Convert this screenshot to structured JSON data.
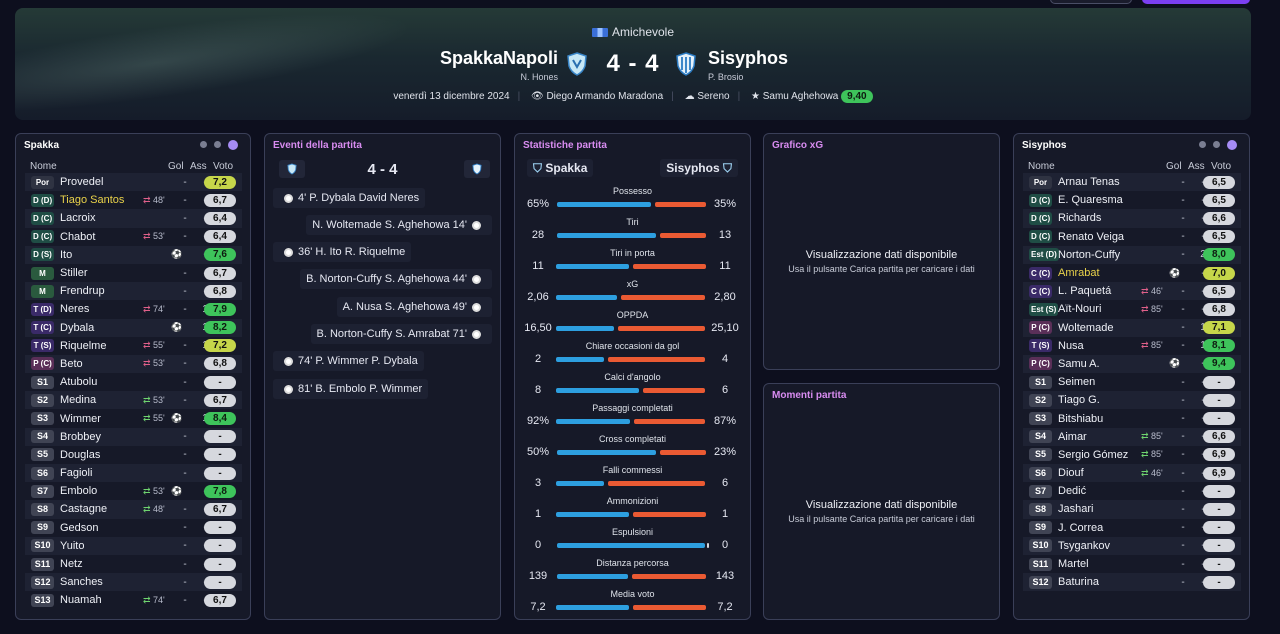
{
  "header": {
    "competition": "Amichevole",
    "home": {
      "name": "SpakkaNapoli",
      "coach": "N. Hones"
    },
    "away": {
      "name": "Sisyphos",
      "coach": "P. Brosio"
    },
    "score": "4 - 4",
    "date": "venerdì 13 dicembre 2024",
    "stadium": "Diego Armando Maradona",
    "weather": "Sereno",
    "mvp": "Samu Aghehowa",
    "mvp_rating": "9,40"
  },
  "labels": {
    "nome": "Nome",
    "gol": "Gol",
    "ass": "Ass",
    "voto": "Voto"
  },
  "home_panel": {
    "title": "Spakka",
    "players": [
      {
        "pos": "Por",
        "name": "Provedel",
        "sub": "",
        "gol": "-",
        "ass": "-",
        "vote": "7,2",
        "cls": "v-ygreen",
        "pc": "gk"
      },
      {
        "pos": "D (D)",
        "name": "Tiago Santos",
        "sub": "48'",
        "subdir": "out",
        "gol": "-",
        "ass": "-",
        "vote": "6,7",
        "cls": "v-gray",
        "pc": "def",
        "hl": true
      },
      {
        "pos": "D (C)",
        "name": "Lacroix",
        "sub": "",
        "gol": "-",
        "ass": "-",
        "vote": "6,4",
        "cls": "v-gray",
        "pc": "def"
      },
      {
        "pos": "D (C)",
        "name": "Chabot",
        "sub": "53'",
        "subdir": "out",
        "gol": "-",
        "ass": "-",
        "vote": "6,4",
        "cls": "v-gray",
        "pc": "def"
      },
      {
        "pos": "D (S)",
        "name": "Ito",
        "sub": "",
        "goalicon": true,
        "gol": "",
        "ass": "-",
        "vote": "7,6",
        "cls": "v-green",
        "pc": "def"
      },
      {
        "pos": "M",
        "name": "Stiller",
        "sub": "",
        "gol": "-",
        "ass": "-",
        "vote": "6,7",
        "cls": "v-gray",
        "pc": "mid"
      },
      {
        "pos": "M",
        "name": "Frendrup",
        "sub": "",
        "gol": "-",
        "ass": "-",
        "vote": "6,8",
        "cls": "v-gray",
        "pc": "mid"
      },
      {
        "pos": "T (D)",
        "name": "Neres",
        "sub": "74'",
        "subdir": "out",
        "gol": "-",
        "ass": "1",
        "vote": "7,9",
        "cls": "v-green",
        "pc": "mix"
      },
      {
        "pos": "T (C)",
        "name": "Dybala",
        "sub": "",
        "goalicon": true,
        "gol": "",
        "ass": "1",
        "vote": "8,2",
        "cls": "v-green",
        "pc": "mix"
      },
      {
        "pos": "T (S)",
        "name": "Riquelme",
        "sub": "55'",
        "subdir": "out",
        "gol": "-",
        "ass": "1",
        "vote": "7,2",
        "cls": "v-ygreen",
        "pc": "mix"
      },
      {
        "pos": "P (C)",
        "name": "Beto",
        "sub": "53'",
        "subdir": "out",
        "gol": "-",
        "ass": "-",
        "vote": "6,8",
        "cls": "v-gray",
        "pc": "att"
      },
      {
        "pos": "S1",
        "name": "Atubolu",
        "sub": "",
        "gol": "-",
        "ass": "-",
        "vote": "-",
        "cls": "v-dash",
        "pc": "sub"
      },
      {
        "pos": "S2",
        "name": "Medina",
        "sub": "53'",
        "subdir": "in",
        "gol": "-",
        "ass": "-",
        "vote": "6,7",
        "cls": "v-gray",
        "pc": "sub"
      },
      {
        "pos": "S3",
        "name": "Wimmer",
        "sub": "55'",
        "subdir": "in",
        "goalicon": true,
        "gol": "",
        "ass": "1",
        "vote": "8,4",
        "cls": "v-green",
        "pc": "sub"
      },
      {
        "pos": "S4",
        "name": "Brobbey",
        "sub": "",
        "gol": "-",
        "ass": "-",
        "vote": "-",
        "cls": "v-dash",
        "pc": "sub"
      },
      {
        "pos": "S5",
        "name": "Douglas",
        "sub": "",
        "gol": "-",
        "ass": "-",
        "vote": "-",
        "cls": "v-dash",
        "pc": "sub"
      },
      {
        "pos": "S6",
        "name": "Fagioli",
        "sub": "",
        "gol": "-",
        "ass": "-",
        "vote": "-",
        "cls": "v-dash",
        "pc": "sub"
      },
      {
        "pos": "S7",
        "name": "Embolo",
        "sub": "53'",
        "subdir": "in",
        "goalicon": true,
        "gol": "",
        "ass": "-",
        "vote": "7,8",
        "cls": "v-green",
        "pc": "sub"
      },
      {
        "pos": "S8",
        "name": "Castagne",
        "sub": "48'",
        "subdir": "in",
        "gol": "-",
        "ass": "-",
        "vote": "6,7",
        "cls": "v-gray",
        "pc": "sub"
      },
      {
        "pos": "S9",
        "name": "Gedson",
        "sub": "",
        "gol": "-",
        "ass": "-",
        "vote": "-",
        "cls": "v-dash",
        "pc": "sub"
      },
      {
        "pos": "S10",
        "name": "Yuito",
        "sub": "",
        "gol": "-",
        "ass": "-",
        "vote": "-",
        "cls": "v-dash",
        "pc": "sub"
      },
      {
        "pos": "S11",
        "name": "Netz",
        "sub": "",
        "gol": "-",
        "ass": "-",
        "vote": "-",
        "cls": "v-dash",
        "pc": "sub"
      },
      {
        "pos": "S12",
        "name": "Sanches",
        "sub": "",
        "gol": "-",
        "ass": "-",
        "vote": "-",
        "cls": "v-dash",
        "pc": "sub"
      },
      {
        "pos": "S13",
        "name": "Nuamah",
        "sub": "74'",
        "subdir": "in",
        "gol": "-",
        "ass": "-",
        "vote": "6,7",
        "cls": "v-gray",
        "pc": "sub"
      }
    ]
  },
  "away_panel": {
    "title": "Sisyphos",
    "players": [
      {
        "pos": "Por",
        "name": "Arnau Tenas",
        "sub": "",
        "gol": "-",
        "ass": "-",
        "vote": "6,5",
        "cls": "v-gray",
        "pc": "gk"
      },
      {
        "pos": "D (C)",
        "name": "E. Quaresma",
        "sub": "",
        "gol": "-",
        "ass": "-",
        "vote": "6,5",
        "cls": "v-gray",
        "pc": "def"
      },
      {
        "pos": "D (C)",
        "name": "Richards",
        "sub": "",
        "gol": "-",
        "ass": "-",
        "vote": "6,6",
        "cls": "v-gray",
        "pc": "def"
      },
      {
        "pos": "D (C)",
        "name": "Renato Veiga",
        "sub": "",
        "gol": "-",
        "ass": "-",
        "vote": "6,5",
        "cls": "v-gray",
        "pc": "def"
      },
      {
        "pos": "Est (D)",
        "name": "Norton-Cuffy",
        "sub": "",
        "gol": "-",
        "ass": "2",
        "vote": "8,0",
        "cls": "v-green",
        "pc": "def"
      },
      {
        "pos": "C (C)",
        "name": "Amrabat",
        "sub": "",
        "goalicon": true,
        "gol": "",
        "ass": "-",
        "vote": "7,0",
        "cls": "v-ygreen",
        "pc": "mix",
        "hl": true
      },
      {
        "pos": "C (C)",
        "name": "L. Paquetá",
        "sub": "46'",
        "subdir": "out",
        "gol": "-",
        "ass": "-",
        "vote": "6,5",
        "cls": "v-gray",
        "pc": "mix"
      },
      {
        "pos": "Est (S)",
        "name": "Aït-Nouri",
        "sub": "85'",
        "subdir": "out",
        "gol": "-",
        "ass": "-",
        "vote": "6,8",
        "cls": "v-gray",
        "pc": "def"
      },
      {
        "pos": "P (C)",
        "name": "Woltemade",
        "sub": "",
        "gol": "-",
        "ass": "1",
        "vote": "7,1",
        "cls": "v-ygreen",
        "pc": "att"
      },
      {
        "pos": "T (S)",
        "name": "Nusa",
        "sub": "85'",
        "subdir": "out",
        "gol": "-",
        "ass": "1",
        "vote": "8,1",
        "cls": "v-green",
        "pc": "mix"
      },
      {
        "pos": "P (C)",
        "name": "Samu A.",
        "sub": "",
        "goalicon": true,
        "gol": "",
        "ass": "-",
        "vote": "9,4",
        "cls": "v-green",
        "pc": "att"
      },
      {
        "pos": "S1",
        "name": "Seimen",
        "sub": "",
        "gol": "-",
        "ass": "-",
        "vote": "-",
        "cls": "v-dash",
        "pc": "sub"
      },
      {
        "pos": "S2",
        "name": "Tiago G.",
        "sub": "",
        "gol": "-",
        "ass": "-",
        "vote": "-",
        "cls": "v-dash",
        "pc": "sub"
      },
      {
        "pos": "S3",
        "name": "Bitshiabu",
        "sub": "",
        "gol": "-",
        "ass": "-",
        "vote": "-",
        "cls": "v-dash",
        "pc": "sub"
      },
      {
        "pos": "S4",
        "name": "Aimar",
        "sub": "85'",
        "subdir": "in",
        "gol": "-",
        "ass": "-",
        "vote": "6,6",
        "cls": "v-gray",
        "pc": "sub"
      },
      {
        "pos": "S5",
        "name": "Sergio Gómez",
        "sub": "85'",
        "subdir": "in",
        "gol": "-",
        "ass": "-",
        "vote": "6,9",
        "cls": "v-gray",
        "pc": "sub"
      },
      {
        "pos": "S6",
        "name": "Diouf",
        "sub": "46'",
        "subdir": "in",
        "gol": "-",
        "ass": "-",
        "vote": "6,9",
        "cls": "v-gray",
        "pc": "sub"
      },
      {
        "pos": "S7",
        "name": "Dedić",
        "sub": "",
        "gol": "-",
        "ass": "-",
        "vote": "-",
        "cls": "v-dash",
        "pc": "sub"
      },
      {
        "pos": "S8",
        "name": "Jashari",
        "sub": "",
        "gol": "-",
        "ass": "-",
        "vote": "-",
        "cls": "v-dash",
        "pc": "sub"
      },
      {
        "pos": "S9",
        "name": "J. Correa",
        "sub": "",
        "gol": "-",
        "ass": "-",
        "vote": "-",
        "cls": "v-dash",
        "pc": "sub"
      },
      {
        "pos": "S10",
        "name": "Tsygankov",
        "sub": "",
        "gol": "-",
        "ass": "-",
        "vote": "-",
        "cls": "v-dash",
        "pc": "sub"
      },
      {
        "pos": "S11",
        "name": "Martel",
        "sub": "",
        "gol": "-",
        "ass": "-",
        "vote": "-",
        "cls": "v-dash",
        "pc": "sub"
      },
      {
        "pos": "S12",
        "name": "Baturina",
        "sub": "",
        "gol": "-",
        "ass": "-",
        "vote": "-",
        "cls": "v-dash",
        "pc": "sub"
      }
    ]
  },
  "events": {
    "title": "Eventi della partita",
    "score": "4 - 4",
    "items": [
      {
        "side": "home",
        "text": "4' P. Dybala David Neres"
      },
      {
        "side": "away",
        "text": "N. Woltemade S. Aghehowa 14'"
      },
      {
        "side": "home",
        "text": "36' H. Ito R. Riquelme"
      },
      {
        "side": "away",
        "text": "B. Norton-Cuffy S. Aghehowa 44'"
      },
      {
        "side": "away",
        "text": "A. Nusa S. Aghehowa 49'"
      },
      {
        "side": "away",
        "text": "B. Norton-Cuffy S. Amrabat 71'"
      },
      {
        "side": "home",
        "text": "74' P. Wimmer P. Dybala"
      },
      {
        "side": "home",
        "text": "81' B. Embolo P. Wimmer"
      }
    ]
  },
  "stats": {
    "title": "Statistiche partita",
    "home": "Spakka",
    "away": "Sisyphos",
    "items": [
      {
        "label": "Possesso",
        "l": "65%",
        "r": "35%",
        "lf": 0.65,
        "rf": 0.35
      },
      {
        "label": "Tiri",
        "l": "28",
        "r": "13",
        "lf": 0.68,
        "rf": 0.32
      },
      {
        "label": "Tiri in porta",
        "l": "11",
        "r": "11",
        "lf": 0.5,
        "rf": 0.5
      },
      {
        "label": "xG",
        "l": "2,06",
        "r": "2,80",
        "lf": 0.42,
        "rf": 0.58
      },
      {
        "label": "OPPDA",
        "l": "16,50",
        "r": "25,10",
        "lf": 0.4,
        "rf": 0.6
      },
      {
        "label": "Chiare occasioni da gol",
        "l": "2",
        "r": "4",
        "lf": 0.33,
        "rf": 0.67
      },
      {
        "label": "Calci d'angolo",
        "l": "8",
        "r": "6",
        "lf": 0.57,
        "rf": 0.43
      },
      {
        "label": "Passaggi completati",
        "l": "92%",
        "r": "87%",
        "lf": 0.51,
        "rf": 0.49
      },
      {
        "label": "Cross completati",
        "l": "50%",
        "r": "23%",
        "lf": 0.68,
        "rf": 0.32
      },
      {
        "label": "Falli commessi",
        "l": "3",
        "r": "6",
        "lf": 0.33,
        "rf": 0.67
      },
      {
        "label": "Ammonizioni",
        "l": "1",
        "r": "1",
        "lf": 0.5,
        "rf": 0.5
      },
      {
        "label": "Espulsioni",
        "l": "0",
        "r": "0",
        "lf": 1.0,
        "rf": 0.0
      },
      {
        "label": "Distanza percorsa",
        "l": "139",
        "r": "143",
        "lf": 0.49,
        "rf": 0.51
      },
      {
        "label": "Media voto",
        "l": "7,2",
        "r": "7,2",
        "lf": 0.5,
        "rf": 0.5
      }
    ]
  },
  "xg": {
    "title": "Grafico xG",
    "msg": "Visualizzazione dati disponibile",
    "sub": "Usa il pulsante Carica partita per caricare i dati"
  },
  "moments": {
    "title": "Momenti partita",
    "msg": "Visualizzazione dati disponibile",
    "sub": "Usa il pulsante Carica partita per caricare i dati"
  }
}
